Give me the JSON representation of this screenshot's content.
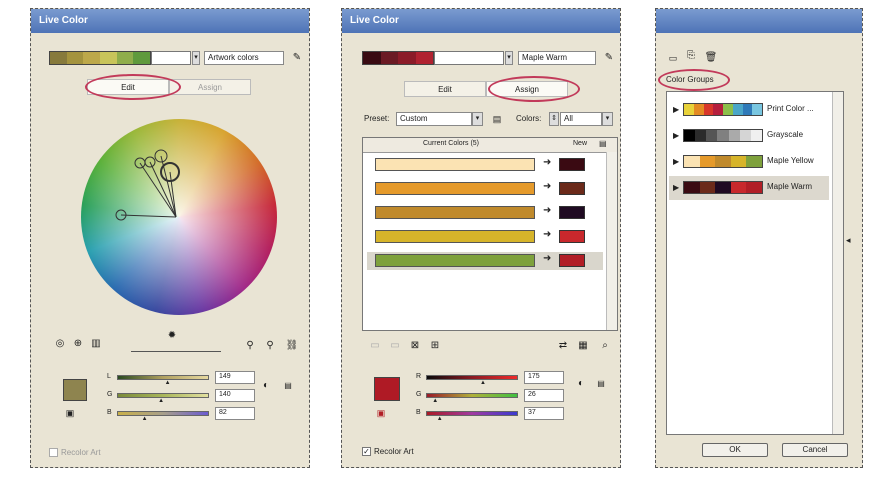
{
  "panel1": {
    "title": "Live Color",
    "group_swatches": [
      "#877a3c",
      "#a4933e",
      "#bda84a",
      "#c8c45a",
      "#8fad4b",
      "#5f9a3d"
    ],
    "group_name": "Artwork colors",
    "tab_edit": "Edit",
    "tab_assign": "Assign",
    "sliders": [
      {
        "label": "L",
        "value": "149"
      },
      {
        "label": "G",
        "value": "140"
      },
      {
        "label": "B",
        "value": "82"
      }
    ],
    "color_swatch": "#8e844f",
    "recolor_label": "Recolor Art"
  },
  "panel2": {
    "title": "Live Color",
    "group_swatches": [
      "#3a0b13",
      "#6b1a24",
      "#8b1b28",
      "#b02230"
    ],
    "group_name": "Maple Warm",
    "tab_edit": "Edit",
    "tab_assign": "Assign",
    "preset_label": "Preset:",
    "preset_value": "Custom",
    "colors_label": "Colors:",
    "colors_value": "All",
    "col_current": "Current Colors (5)",
    "col_new": "New",
    "rows": [
      {
        "current": "#fbe3b3",
        "new": "#3a0a12"
      },
      {
        "current": "#e59a2b",
        "new": "#6b2a1a"
      },
      {
        "current": "#c08a2c",
        "new": "#1f0a22"
      },
      {
        "current": "#d6b42a",
        "new": "#c8282c"
      },
      {
        "current": "#7ea13c",
        "new": "#b11e26"
      }
    ],
    "sliders": [
      {
        "label": "R",
        "value": "175"
      },
      {
        "label": "G",
        "value": "26"
      },
      {
        "label": "B",
        "value": "37"
      }
    ],
    "color_swatch": "#af1a25",
    "recolor_label": "Recolor Art"
  },
  "panel3": {
    "section_label": "Color Groups",
    "groups": [
      {
        "name": "Print Color ...",
        "swatches": [
          "#e8d23a",
          "#e38a23",
          "#d8372a",
          "#b51f3d",
          "#8cbf4a",
          "#4aa6c8",
          "#2f7ab9",
          "#79c6e0"
        ]
      },
      {
        "name": "Grayscale",
        "swatches": [
          "#000000",
          "#2b2b2b",
          "#555555",
          "#808080",
          "#aaaaaa",
          "#d5d5d5",
          "#f0f0f0"
        ]
      },
      {
        "name": "Maple Yellow",
        "swatches": [
          "#fbe3b3",
          "#e59a2b",
          "#c08a2c",
          "#d6b42a",
          "#7ea13c"
        ]
      },
      {
        "name": "Maple Warm",
        "swatches": [
          "#3a0a12",
          "#6b2a1a",
          "#1f0a22",
          "#c8282c",
          "#b11e26"
        ]
      }
    ],
    "ok_label": "OK",
    "cancel_label": "Cancel"
  }
}
